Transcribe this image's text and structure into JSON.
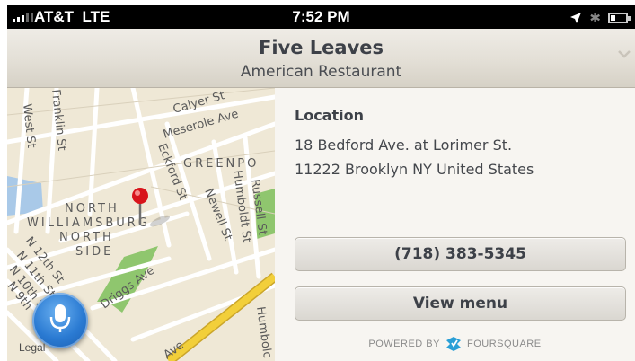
{
  "status_bar": {
    "carrier": "AT&T",
    "network": "LTE",
    "time": "7:52 PM",
    "battery_level": 0.25
  },
  "header": {
    "title": "Five Leaves",
    "subtitle": "American Restaurant"
  },
  "map": {
    "legal_label": "Legal",
    "streets": {
      "calyer": "Calyer St",
      "meserole": "Meserole Ave",
      "west": "West St",
      "franklin": "Franklin St",
      "eckford": "Eckford St",
      "newell": "Newell St",
      "humboldt": "Humboldt St",
      "russell": "Russell St",
      "driggs": "Driggs Ave",
      "n12": "N 12th St",
      "n11": "N 11th St",
      "n10": "N 10th St",
      "n9": "N 9th",
      "humbolt_lower": "Humbolc",
      "ave": "Ave"
    },
    "neighborhoods": {
      "greenpoint": "GREENPO",
      "north": "NORTH",
      "williamsburg": "WILLIAMSBURG",
      "north2": "NORTH",
      "side": "SIDE"
    }
  },
  "info": {
    "location_label": "Location",
    "address_line1": "18 Bedford Ave. at Lorimer St.",
    "address_line2": "11222 Brooklyn NY United States",
    "phone_button": "(718) 383-5345",
    "menu_button": "View menu",
    "powered_by": "POWERED BY",
    "provider": "FOURSQUARE"
  },
  "colors": {
    "brand_blue": "#2a9fd6",
    "pin_red": "#d8141b",
    "park_green": "#8fc66e",
    "water": "#a9c9e8",
    "highway": "#f2cf3a"
  }
}
